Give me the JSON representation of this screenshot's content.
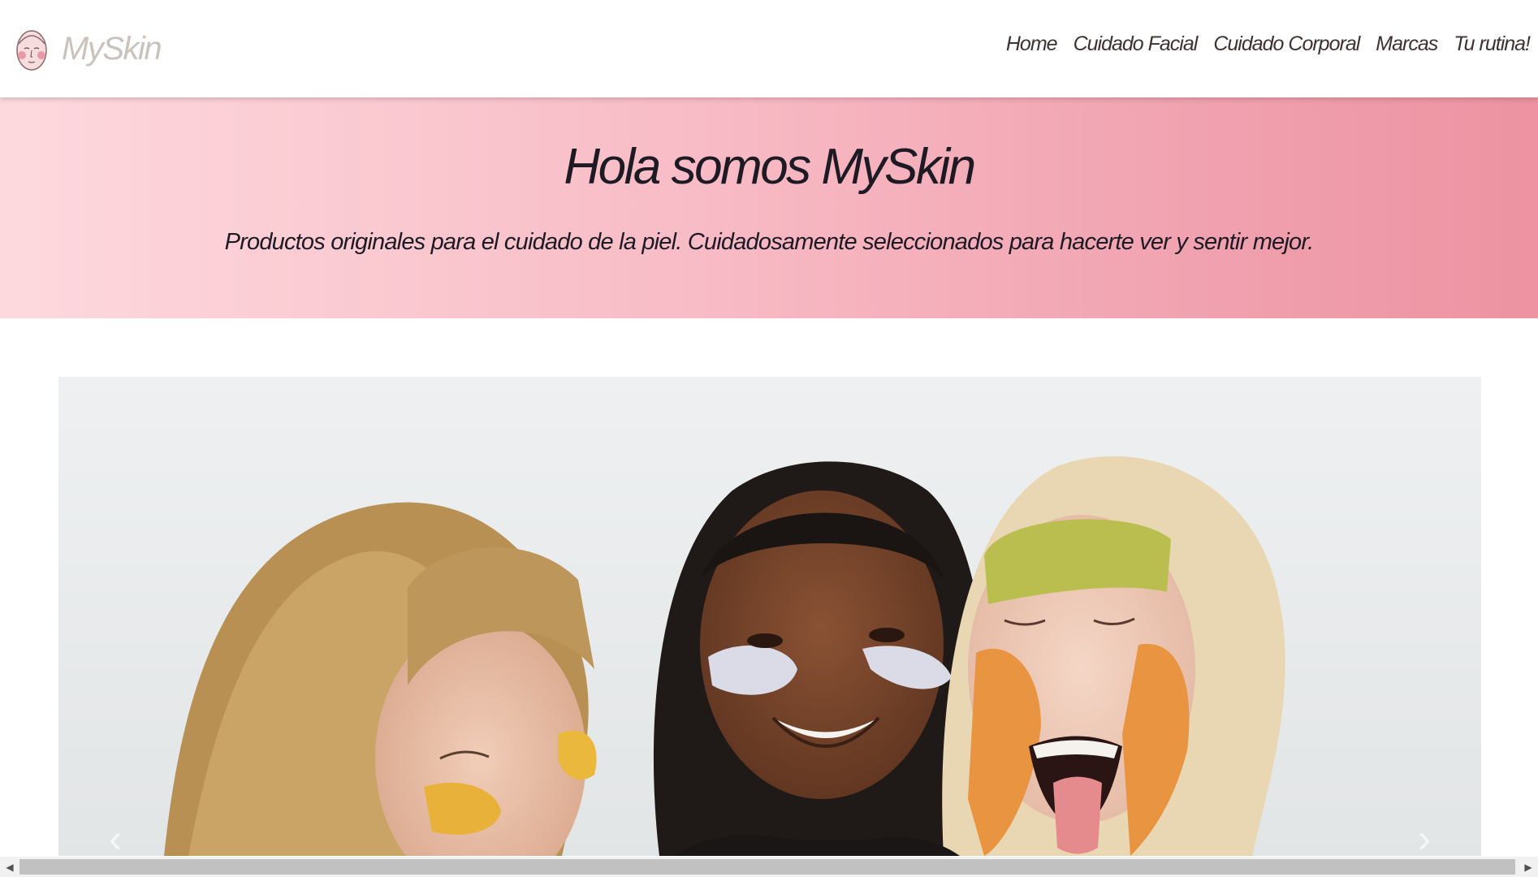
{
  "brand": {
    "name": "MySkin",
    "logo_icon": "face-logo-icon"
  },
  "nav": {
    "items": [
      {
        "label": "Home"
      },
      {
        "label": "Cuidado Facial"
      },
      {
        "label": "Cuidado Corporal"
      },
      {
        "label": "Marcas"
      },
      {
        "label": "Tu rutina!"
      }
    ]
  },
  "hero": {
    "title": "Hola somos MySkin",
    "subtitle": "Productos originales para el cuidado de la piel. Cuidadosamente seleccionados para hacerte ver y sentir mejor."
  },
  "carousel": {
    "prev_icon": "chevron-left-icon",
    "next_icon": "chevron-right-icon"
  },
  "colors": {
    "hero_gradient_start": "#fdd9de",
    "hero_gradient_end": "#ed93a2",
    "brand_text": "#c9c2bd",
    "nav_text": "#3d3231",
    "heading_text": "#1e1a24"
  }
}
